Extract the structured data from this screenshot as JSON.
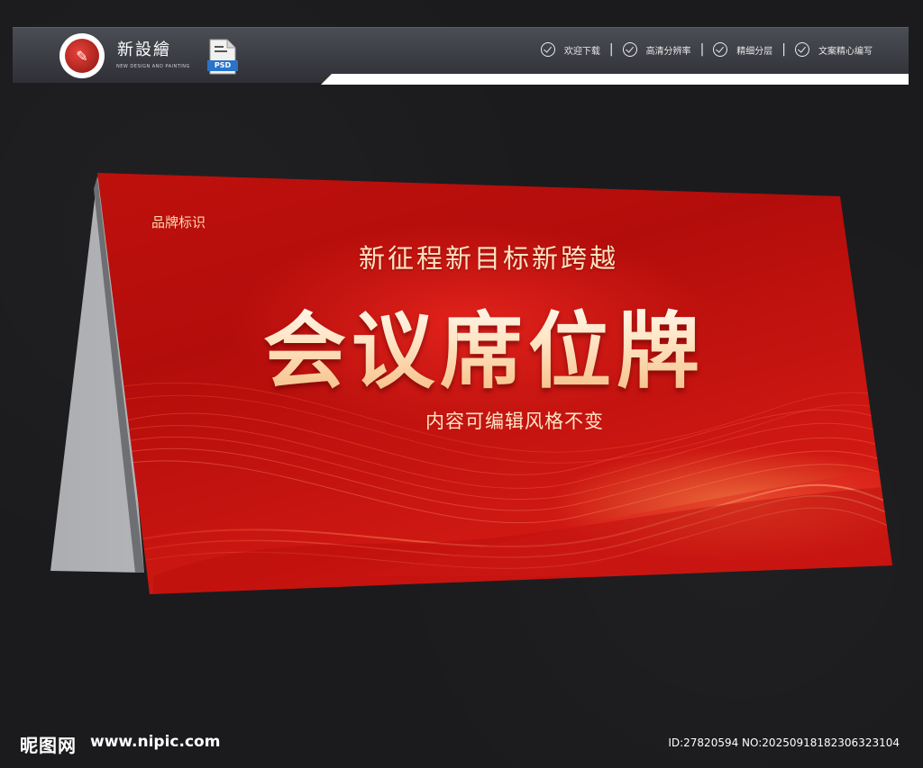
{
  "header": {
    "brand_title": "新設繪",
    "brand_subtitle": "NEW DESIGN AND PAINTING",
    "file_type": "PSD",
    "features": [
      "欢迎下载",
      "高清分辨率",
      "精细分层",
      "文案精心编写"
    ],
    "separator": "|"
  },
  "card": {
    "brand_mark": "品牌标识",
    "slogan": "新征程新目标新跨越",
    "title": "会议席位牌",
    "subtitle": "内容可编辑风格不变",
    "colors": {
      "red": "#c8130f",
      "gold": "#ffe2c0",
      "back": "#c4c5c8"
    }
  },
  "footer": {
    "site_logo": "昵图网",
    "url": "www.nipic.com",
    "id_text": "ID:27820594 NO:20250918182306323104"
  }
}
